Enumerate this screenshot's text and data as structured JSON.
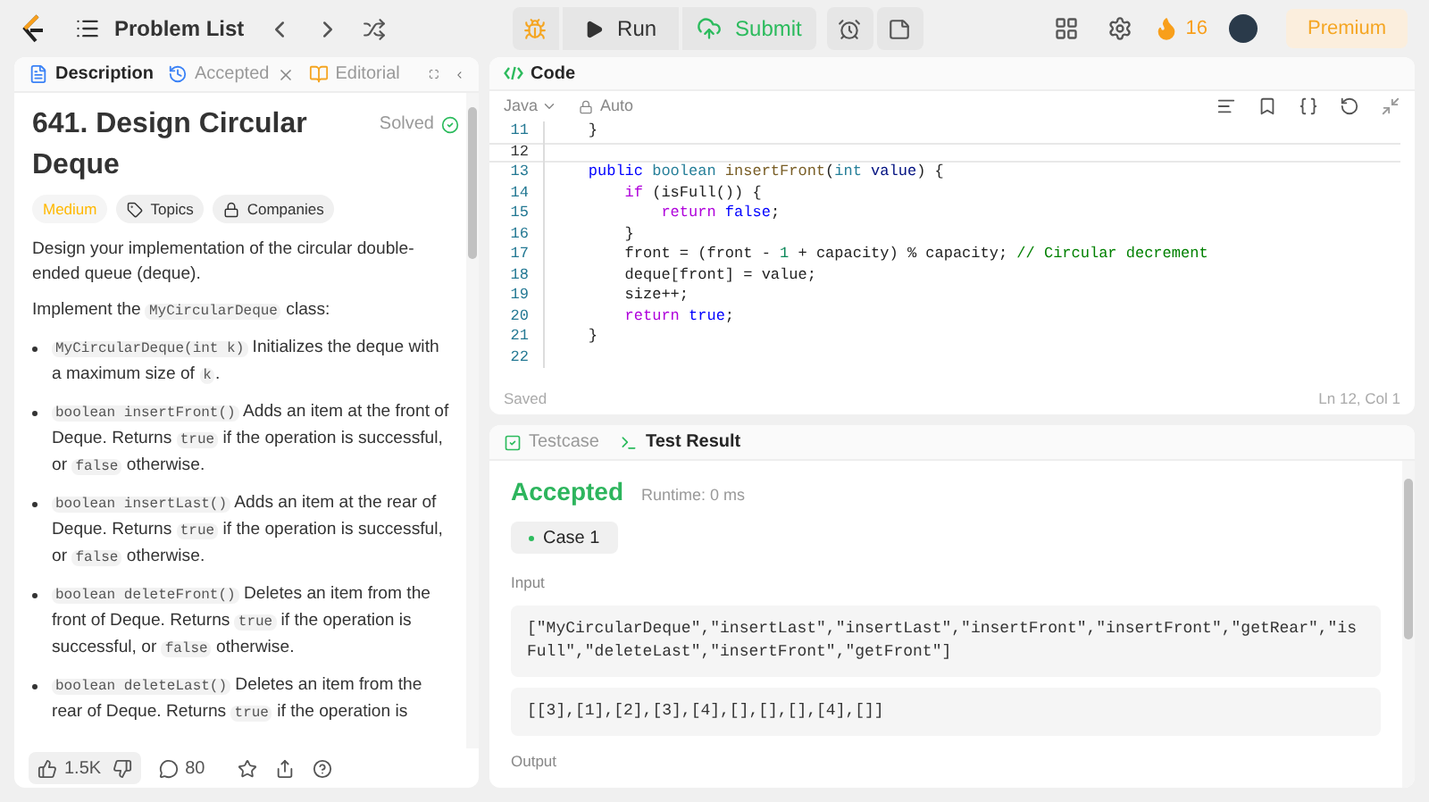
{
  "topbar": {
    "problem_list": "Problem List",
    "run": "Run",
    "submit": "Submit",
    "streak": "16",
    "premium": "Premium"
  },
  "left_tabs": [
    {
      "label": "Description",
      "selected": true,
      "kind": "description"
    },
    {
      "label": "Accepted",
      "selected": false,
      "kind": "accepted"
    },
    {
      "label": "Editorial",
      "selected": false,
      "kind": "editorial"
    }
  ],
  "problem": {
    "title": "641. Design Circular Deque",
    "status": "Solved",
    "difficulty": "Medium",
    "tags": [
      {
        "label": "Topics",
        "kind": "topics"
      },
      {
        "label": "Companies",
        "kind": "companies"
      }
    ],
    "paragraphs": [
      [
        {
          "text": "Design your implementation of the circular double-ended queue (deque).",
          "kind": "text"
        }
      ],
      [
        {
          "text": "Implement the ",
          "kind": "text"
        },
        {
          "text": "MyCircularDeque",
          "kind": "code"
        },
        {
          "text": " class:",
          "kind": "text"
        }
      ]
    ],
    "bullets": [
      [
        {
          "text": "MyCircularDeque(int k)",
          "kind": "code"
        },
        {
          "text": " Initializes the deque with a maximum size of ",
          "kind": "text"
        },
        {
          "text": "k",
          "kind": "code"
        },
        {
          "text": ".",
          "kind": "text"
        }
      ],
      [
        {
          "text": "boolean insertFront()",
          "kind": "code"
        },
        {
          "text": " Adds an item at the front of Deque. Returns ",
          "kind": "text"
        },
        {
          "text": "true",
          "kind": "code"
        },
        {
          "text": " if the operation is successful, or ",
          "kind": "text"
        },
        {
          "text": "false",
          "kind": "code"
        },
        {
          "text": " otherwise.",
          "kind": "text"
        }
      ],
      [
        {
          "text": "boolean insertLast()",
          "kind": "code"
        },
        {
          "text": " Adds an item at the rear of Deque. Returns ",
          "kind": "text"
        },
        {
          "text": "true",
          "kind": "code"
        },
        {
          "text": " if the operation is successful, or ",
          "kind": "text"
        },
        {
          "text": "false",
          "kind": "code"
        },
        {
          "text": " otherwise.",
          "kind": "text"
        }
      ],
      [
        {
          "text": "boolean deleteFront()",
          "kind": "code"
        },
        {
          "text": " Deletes an item from the front of Deque. Returns ",
          "kind": "text"
        },
        {
          "text": "true",
          "kind": "code"
        },
        {
          "text": " if the operation is successful, or ",
          "kind": "text"
        },
        {
          "text": "false",
          "kind": "code"
        },
        {
          "text": " otherwise.",
          "kind": "text"
        }
      ],
      [
        {
          "text": "boolean deleteLast()",
          "kind": "code"
        },
        {
          "text": " Deletes an item from the rear of Deque. Returns ",
          "kind": "text"
        },
        {
          "text": "true",
          "kind": "code"
        },
        {
          "text": " if the operation is",
          "kind": "text"
        }
      ]
    ],
    "likes": "1.5K",
    "comments": "80"
  },
  "code": {
    "title": "Code",
    "language": "Java",
    "mode": "Auto",
    "status": "Saved",
    "cursor": "Ln 12, Col 1",
    "lines": [
      {
        "number": "11",
        "tokens": [
          {
            "text": "    }",
            "kind": "plain"
          }
        ],
        "current": false
      },
      {
        "number": "12",
        "current": true
      },
      {
        "number": "13",
        "tokens": [
          {
            "text": "    public ",
            "kind": "keyword"
          },
          {
            "text": "boolean ",
            "kind": "type"
          },
          {
            "text": "insertFront",
            "kind": "function"
          },
          {
            "text": "(",
            "kind": "plain"
          },
          {
            "text": "int ",
            "kind": "type"
          },
          {
            "text": "value",
            "kind": "variable"
          },
          {
            "text": ") {",
            "kind": "plain"
          }
        ],
        "current": false
      },
      {
        "number": "14",
        "tokens": [
          {
            "text": "        if ",
            "kind": "control"
          },
          {
            "text": "(isFull()) {",
            "kind": "plain"
          }
        ],
        "current": false
      },
      {
        "number": "15",
        "tokens": [
          {
            "text": "            return ",
            "kind": "control"
          },
          {
            "text": "false",
            "kind": "keyword"
          },
          {
            "text": ";",
            "kind": "plain"
          }
        ],
        "current": false
      },
      {
        "number": "16",
        "tokens": [
          {
            "text": "        }",
            "kind": "plain"
          }
        ],
        "current": false
      },
      {
        "number": "17",
        "tokens": [
          {
            "text": "        front = (front - ",
            "kind": "plain"
          },
          {
            "text": "1",
            "kind": "number"
          },
          {
            "text": " + capacity) % capacity; ",
            "kind": "plain"
          },
          {
            "text": "// Circular decrement",
            "kind": "comment"
          }
        ],
        "current": false
      },
      {
        "number": "18",
        "tokens": [
          {
            "text": "        deque[front] = value;",
            "kind": "plain"
          }
        ],
        "current": false
      },
      {
        "number": "19",
        "tokens": [
          {
            "text": "        size++;",
            "kind": "plain"
          }
        ],
        "current": false
      },
      {
        "number": "20",
        "tokens": [
          {
            "text": "        return ",
            "kind": "control"
          },
          {
            "text": "true",
            "kind": "keyword"
          },
          {
            "text": ";",
            "kind": "plain"
          }
        ],
        "current": false
      },
      {
        "number": "21",
        "tokens": [
          {
            "text": "    }",
            "kind": "plain"
          }
        ],
        "current": false
      },
      {
        "number": "22",
        "current": false
      }
    ]
  },
  "result_tabs": [
    {
      "label": "Testcase",
      "selected": false,
      "kind": "testcase"
    },
    {
      "label": "Test Result",
      "selected": true,
      "kind": "result"
    }
  ],
  "result": {
    "verdict": "Accepted",
    "runtime": "Runtime: 0 ms",
    "cases": [
      {
        "label": "Case 1",
        "selected": true
      }
    ],
    "input_label": "Input",
    "inputs": [
      "[\"MyCircularDeque\",\"insertLast\",\"insertLast\",\"insertFront\",\"insertFront\",\"getRear\",\"isFull\",\"deleteLast\",\"insertFront\",\"getFront\"]",
      "[[3],[1],[2],[3],[4],[],[],[],[4],[]]"
    ],
    "output_label": "Output"
  }
}
